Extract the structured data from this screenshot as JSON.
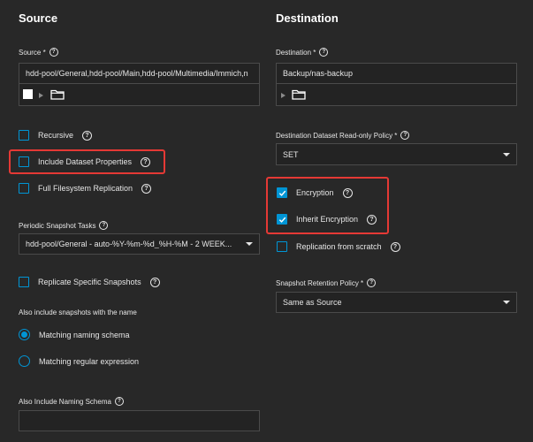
{
  "source": {
    "title": "Source",
    "source_label": "Source *",
    "source_value": "hdd-pool/General,hdd-pool/Main,hdd-pool/Multimedia/Immich,n",
    "recursive_label": "Recursive",
    "include_props_label": "Include Dataset Properties",
    "full_fs_label": "Full Filesystem Replication",
    "periodic_label": "Periodic Snapshot Tasks",
    "periodic_value": "hdd-pool/General - auto-%Y-%m-%d_%H-%M - 2 WEEK...",
    "replicate_specific_label": "Replicate Specific Snapshots",
    "also_include_label": "Also include snapshots with the name",
    "radio_matching_schema": "Matching naming schema",
    "radio_matching_regex": "Matching regular expression",
    "naming_schema_label": "Also Include Naming Schema",
    "naming_schema_value": ""
  },
  "destination": {
    "title": "Destination",
    "dest_label": "Destination *",
    "dest_value": "Backup/nas-backup",
    "readonly_label": "Destination Dataset Read-only Policy *",
    "readonly_value": "SET",
    "encryption_label": "Encryption",
    "inherit_label": "Inherit Encryption",
    "scratch_label": "Replication from scratch",
    "retention_label": "Snapshot Retention Policy *",
    "retention_value": "Same as Source"
  },
  "state": {
    "recursive": false,
    "include_dataset_properties": false,
    "full_filesystem_replication": false,
    "replicate_specific_snapshots": false,
    "encryption": true,
    "inherit_encryption": true,
    "replication_from_scratch": false,
    "snapshot_name_mode": "Matching naming schema"
  },
  "colors": {
    "accent": "#0095d5",
    "highlight_box": "#e53935",
    "background": "#282828"
  },
  "icons": {
    "help": "help-circle-icon",
    "folder": "folder-icon",
    "expand": "triangle-right-icon",
    "dropdown": "chevron-down-icon"
  }
}
